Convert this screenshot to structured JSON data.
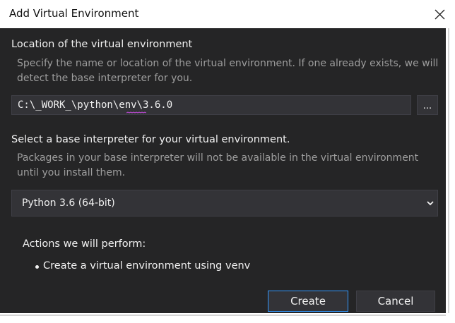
{
  "window": {
    "title": "Add Virtual Environment"
  },
  "location": {
    "heading": "Location of the virtual environment",
    "description": "Specify the name or location of the virtual environment. If one already exists, we will detect the base interpreter for you.",
    "path_value": "C:\\_WORK_\\python\\env\\3.6.0",
    "browse_label": "..."
  },
  "interpreter": {
    "heading": "Select a base interpreter for your virtual environment.",
    "description": "Packages in your base interpreter will not be available in the virtual environment until you install them.",
    "selected": "Python 3.6 (64-bit)"
  },
  "actions": {
    "title": "Actions we will perform:",
    "items": [
      "Create a virtual environment using venv"
    ]
  },
  "buttons": {
    "create": "Create",
    "cancel": "Cancel"
  },
  "colors": {
    "background": "#252526",
    "control": "#333337",
    "accent": "#3399ff",
    "text": "#f1f1f1",
    "muted_text": "#9d9d9d",
    "spellcheck": "#c04ad8"
  },
  "icons": {
    "close": "close-icon",
    "dropdown": "chevron-down-icon"
  }
}
